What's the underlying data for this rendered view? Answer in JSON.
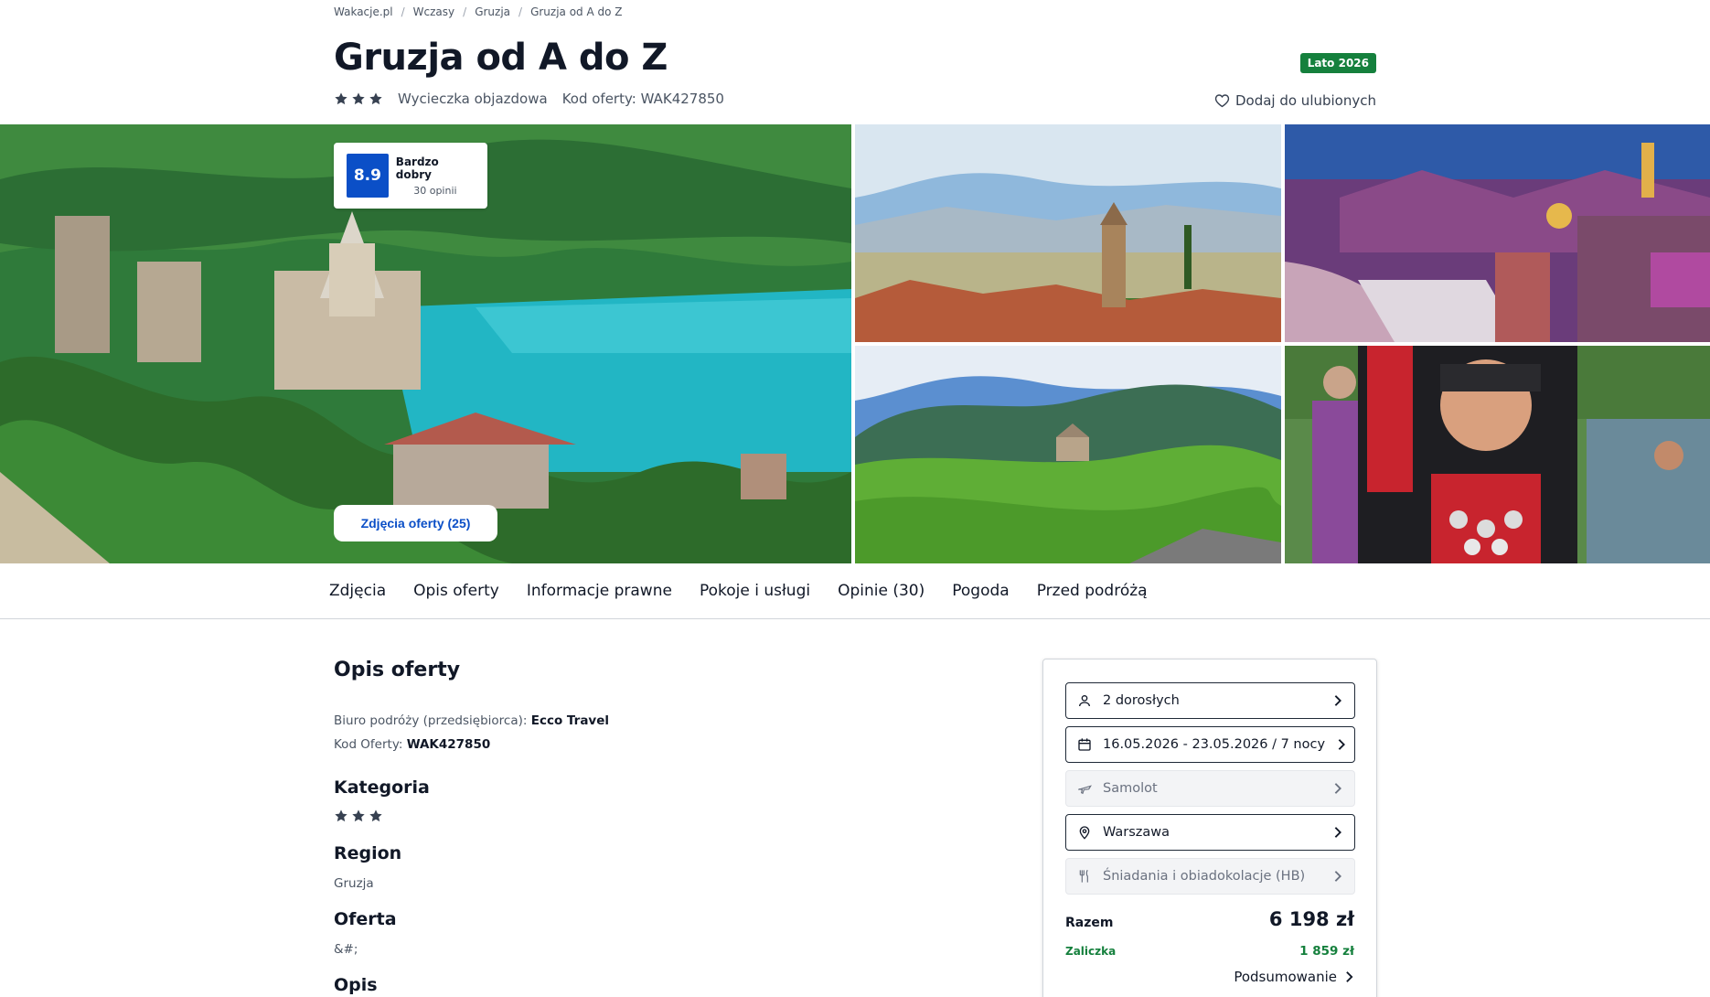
{
  "breadcrumb": [
    "Wakacje.pl",
    "Wczasy",
    "Gruzja",
    "Gruzja od A do Z"
  ],
  "title": "Gruzja od A do Z",
  "category_stars": 3,
  "trip_type": "Wycieczka objazdowa",
  "offer_code_text": "Kod oferty: WAK427850",
  "season_badge": "Lato 2026",
  "favorites_label": "Dodaj do ulubionych",
  "rating": {
    "score": "8.9",
    "label": "Bardzo dobry",
    "count": "30 opinii"
  },
  "photos_button": "Zdjęcia oferty (25)",
  "tabs": [
    "Zdjęcia",
    "Opis oferty",
    "Informacje prawne",
    "Pokoje i usługi",
    "Opinie (30)",
    "Pogoda",
    "Przed podróżą"
  ],
  "description": {
    "heading": "Opis oferty",
    "organizer_label": "Biuro podróży (przedsiębiorca):",
    "organizer_value": "Ecco Travel",
    "code_label": "Kod Oferty:",
    "code_value": "WAK427850",
    "category_heading": "Kategoria",
    "region_heading": "Region",
    "region_value": "Gruzja",
    "offer_heading": "Oferta",
    "offer_value": "&#;",
    "opis_heading": "Opis"
  },
  "booking": {
    "travellers": "2 dorosłych",
    "dates": "16.05.2026 - 23.05.2026 / 7 nocy",
    "transport": "Samolot",
    "departure": "Warszawa",
    "board": "Śniadania i obiadokolacje (HB)",
    "total_label": "Razem",
    "total_value": "6 198 zł",
    "deposit_label": "Zaliczka",
    "deposit_value": "1 859 zł",
    "summary_label": "Podsumowanie"
  },
  "colors": {
    "accent_blue": "#0b4fc7",
    "badge_green": "#15803d"
  }
}
